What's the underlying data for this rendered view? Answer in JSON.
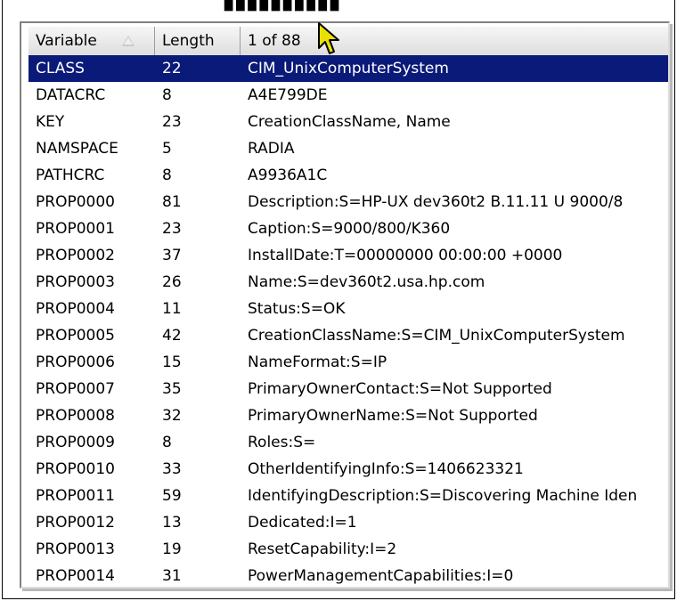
{
  "header": {
    "col_variable": "Variable",
    "col_length": "Length",
    "col_value": "1 of 88",
    "sort_icon": "sort-ascending-icon"
  },
  "rows": [
    {
      "variable": "CLASS",
      "length": "22",
      "value": "CIM_UnixComputerSystem",
      "selected": true
    },
    {
      "variable": "DATACRC",
      "length": "8",
      "value": "A4E799DE"
    },
    {
      "variable": "KEY",
      "length": "23",
      "value": "CreationClassName, Name"
    },
    {
      "variable": "NAMSPACE",
      "length": "5",
      "value": "RADIA"
    },
    {
      "variable": "PATHCRC",
      "length": "8",
      "value": "A9936A1C"
    },
    {
      "variable": "PROP0000",
      "length": "81",
      "value": "Description:S=HP-UX dev360t2 B.11.11 U 9000/8"
    },
    {
      "variable": "PROP0001",
      "length": "23",
      "value": "Caption:S=9000/800/K360"
    },
    {
      "variable": "PROP0002",
      "length": "37",
      "value": "InstallDate:T=00000000 00:00:00 +0000"
    },
    {
      "variable": "PROP0003",
      "length": "26",
      "value": "Name:S=dev360t2.usa.hp.com"
    },
    {
      "variable": "PROP0004",
      "length": "11",
      "value": "Status:S=OK"
    },
    {
      "variable": "PROP0005",
      "length": "42",
      "value": "CreationClassName:S=CIM_UnixComputerSystem"
    },
    {
      "variable": "PROP0006",
      "length": "15",
      "value": "NameFormat:S=IP"
    },
    {
      "variable": "PROP0007",
      "length": "35",
      "value": "PrimaryOwnerContact:S=Not Supported"
    },
    {
      "variable": "PROP0008",
      "length": "32",
      "value": "PrimaryOwnerName:S=Not Supported"
    },
    {
      "variable": "PROP0009",
      "length": "8",
      "value": "Roles:S="
    },
    {
      "variable": "PROP0010",
      "length": "33",
      "value": "OtherIdentifyingInfo:S=1406623321"
    },
    {
      "variable": "PROP0011",
      "length": "59",
      "value": "IdentifyingDescription:S=Discovering Machine Iden"
    },
    {
      "variable": "PROP0012",
      "length": "13",
      "value": "Dedicated:I=1"
    },
    {
      "variable": "PROP0013",
      "length": "19",
      "value": "ResetCapability:I=2"
    },
    {
      "variable": "PROP0014",
      "length": "31",
      "value": "PowerManagementCapabilities:I=0"
    }
  ],
  "colors": {
    "selection": "#0a1a78",
    "selection_text": "#ffffff",
    "cursor": "#e8e000"
  },
  "cursor_icon": "mouse-pointer-icon"
}
